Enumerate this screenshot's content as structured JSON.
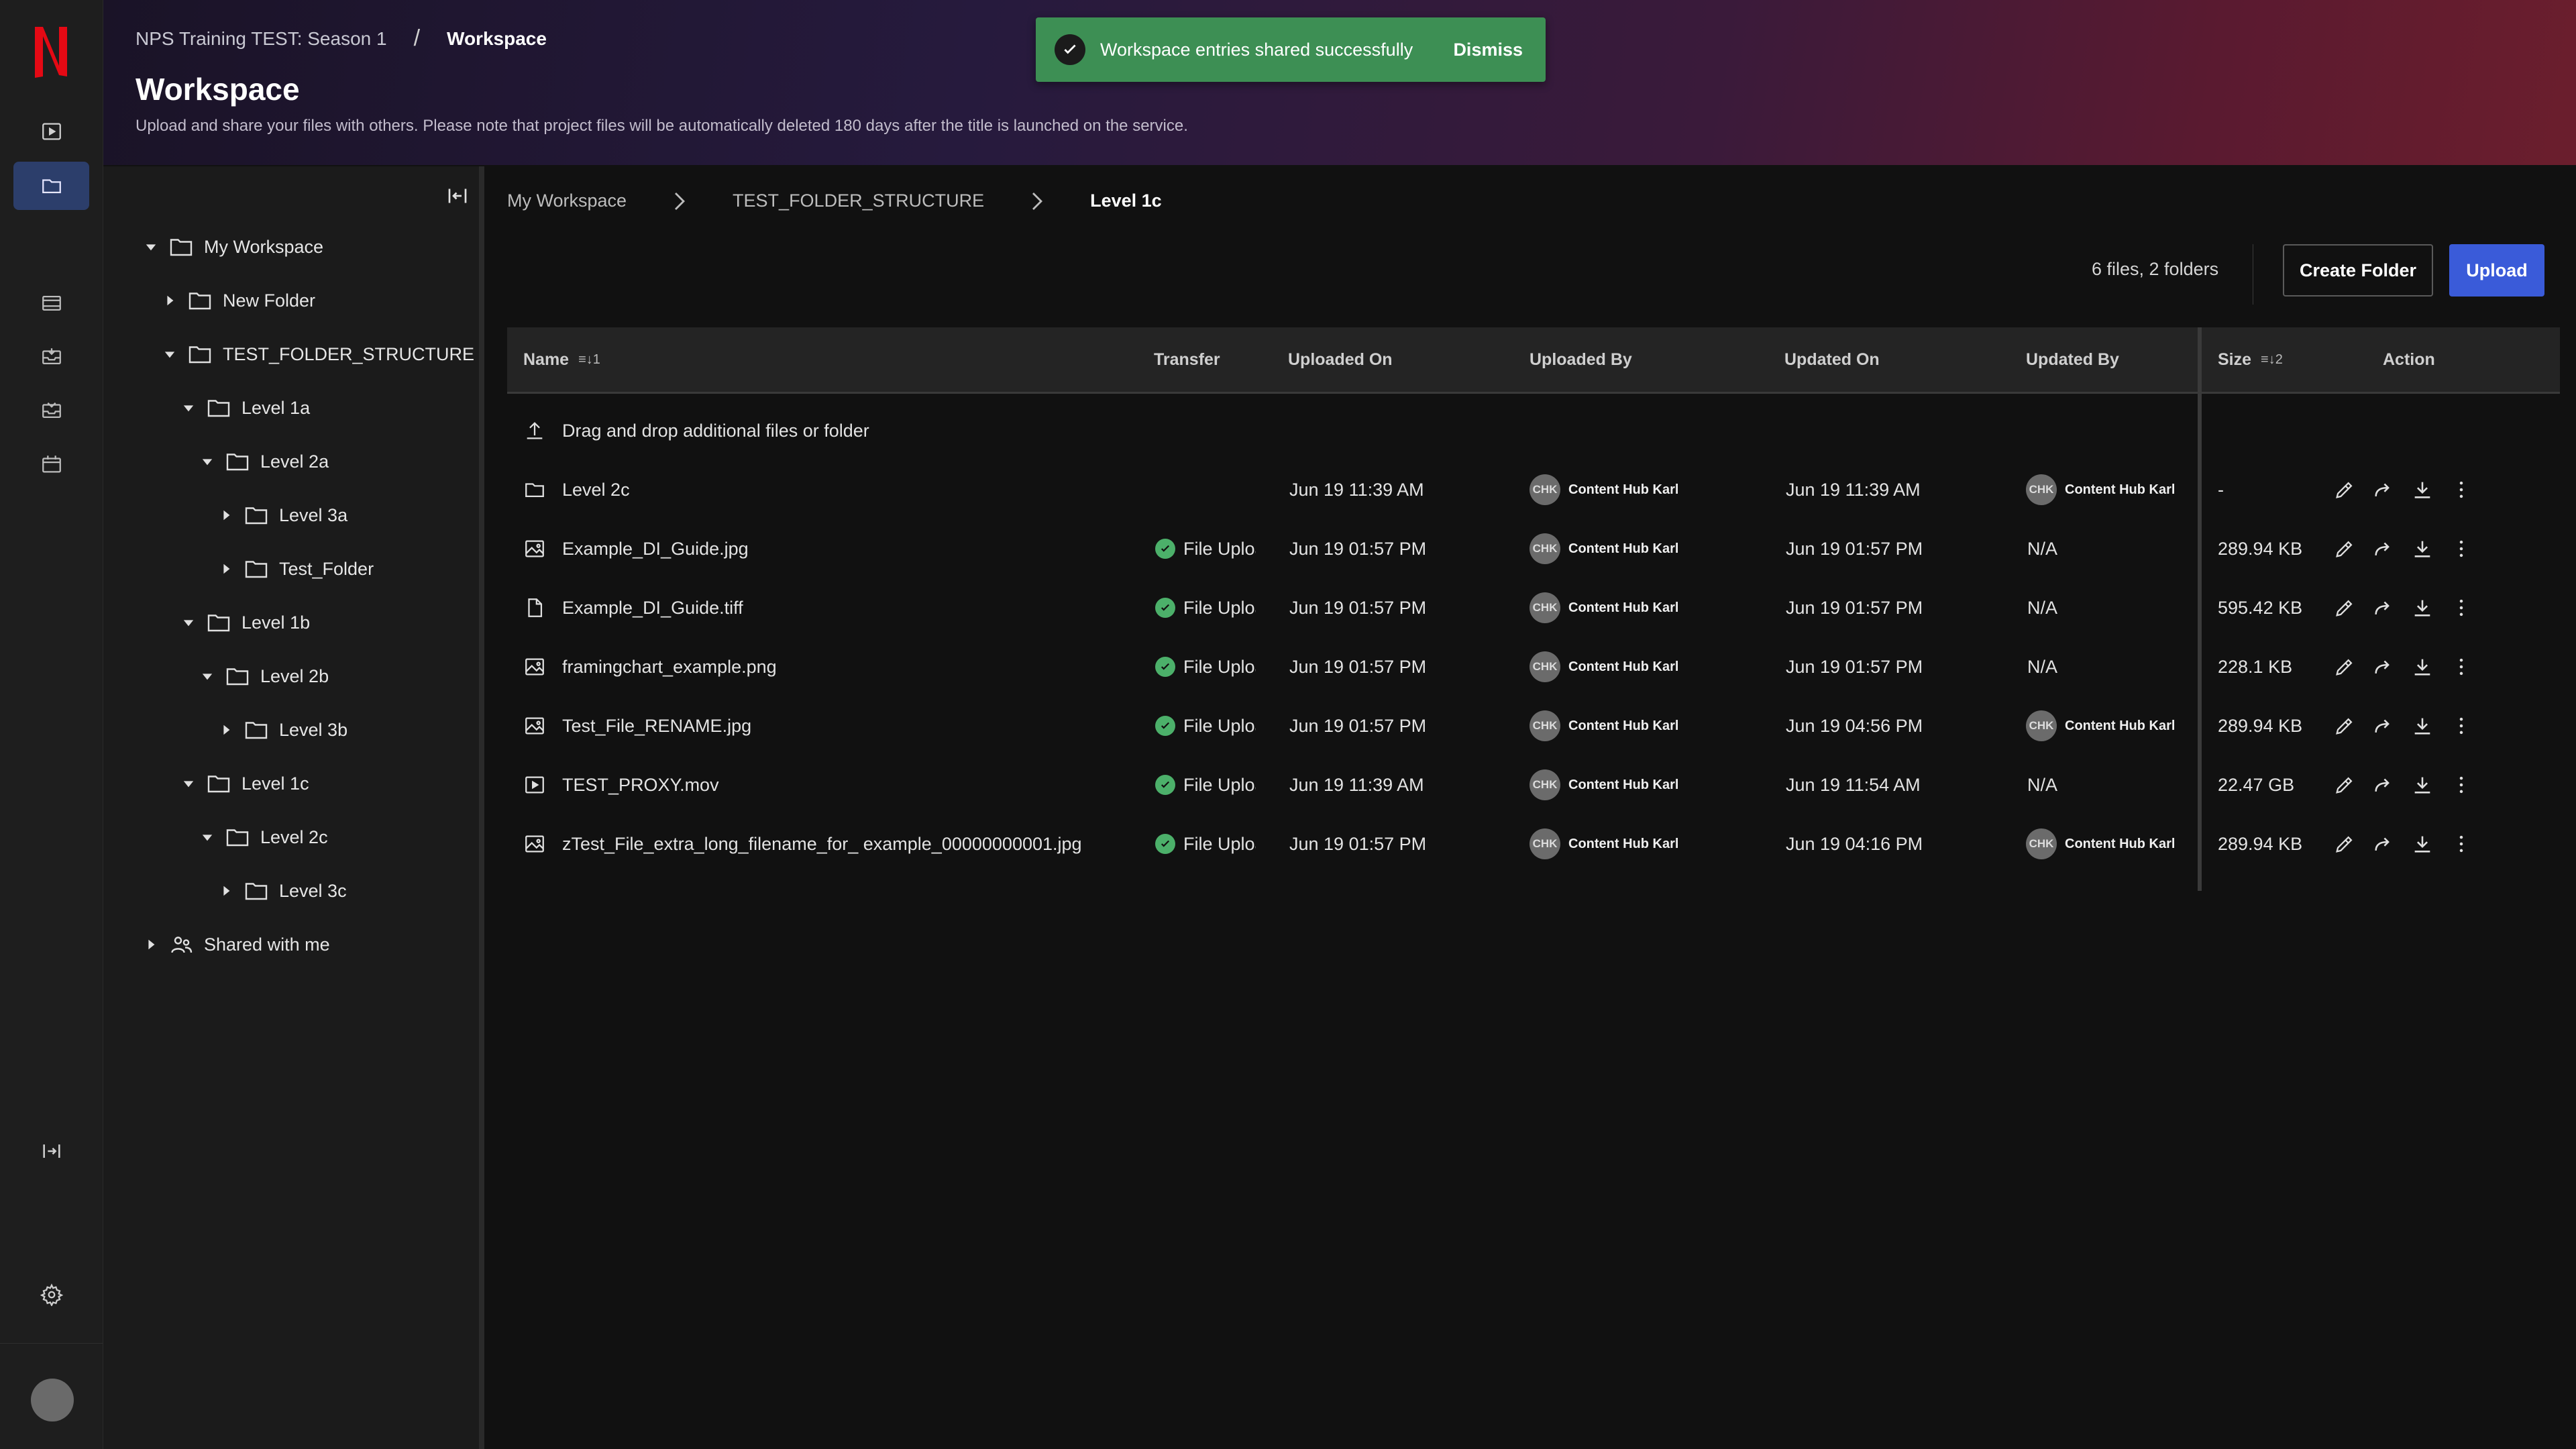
{
  "header": {
    "breadcrumb_project": "NPS Training TEST: Season 1",
    "breadcrumb_sep": "/",
    "breadcrumb_current": "Workspace",
    "title": "Workspace",
    "subtitle": "Upload and share your files with others. Please note that project files will be automatically deleted 180 days after the title is launched on the service."
  },
  "toast": {
    "message": "Workspace entries shared successfully",
    "dismiss_label": "Dismiss",
    "color": "#3d8f54"
  },
  "rail": {
    "icons": [
      "netflix-logo",
      "video-icon",
      "folder-icon",
      "film-icon",
      "inbox-icon",
      "inbox-download-icon",
      "calendar-icon",
      "expand-panel-icon",
      "gear-icon",
      "avatar"
    ]
  },
  "tree": {
    "items": [
      {
        "label": "My Workspace",
        "expanded": true
      },
      {
        "label": "New Folder",
        "expanded": false
      },
      {
        "label": "TEST_FOLDER_STRUCTURE",
        "expanded": true
      },
      {
        "label": "Level 1a",
        "expanded": true
      },
      {
        "label": "Level 2a",
        "expanded": true
      },
      {
        "label": "Level 3a",
        "expanded": false
      },
      {
        "label": "Test_Folder",
        "expanded": false
      },
      {
        "label": "Level 1b",
        "expanded": true
      },
      {
        "label": "Level 2b",
        "expanded": true
      },
      {
        "label": "Level 3b",
        "expanded": false
      },
      {
        "label": "Level 1c",
        "expanded": true
      },
      {
        "label": "Level 2c",
        "expanded": true
      },
      {
        "label": "Level 3c",
        "expanded": false
      },
      {
        "label": "Shared with me",
        "expanded": false
      }
    ]
  },
  "main": {
    "breadcrumb": [
      "My Workspace",
      "TEST_FOLDER_STRUCTURE",
      "Level 1c"
    ],
    "count": "6 files, 2 folders",
    "create_folder_label": "Create Folder",
    "upload_label": "Upload",
    "accent": "#3a5bd9"
  },
  "table": {
    "headers": {
      "name": "Name",
      "name_sort": "1",
      "transfer": "Transfer",
      "uploaded_on": "Uploaded On",
      "uploaded_by": "Uploaded By",
      "updated_on": "Updated On",
      "updated_by": "Updated By",
      "size": "Size",
      "size_sort": "2",
      "action": "Action"
    },
    "dropzone": "Drag and drop additional files or folder",
    "rows": [
      {
        "icon": "folder-icon",
        "name": "Level 2c",
        "transfer": "",
        "uploaded_on": "Jun 19 11:39 AM",
        "uploaded_by_initials": "CHK",
        "uploaded_by": "Content Hub Karl",
        "updated_on": "Jun 19 11:39 AM",
        "updated_by_initials": "CHK",
        "updated_by": "Content Hub Karl",
        "size": "-"
      },
      {
        "icon": "image-icon",
        "name": "Example_DI_Guide.jpg",
        "transfer": "File Uploa",
        "uploaded_on": "Jun 19 01:57 PM",
        "uploaded_by_initials": "CHK",
        "uploaded_by": "Content Hub Karl",
        "updated_on": "Jun 19 01:57 PM",
        "updated_by_initials": "",
        "updated_by": "N/A",
        "size": "289.94 KB"
      },
      {
        "icon": "file-icon",
        "name": "Example_DI_Guide.tiff",
        "transfer": "File Uploa",
        "uploaded_on": "Jun 19 01:57 PM",
        "uploaded_by_initials": "CHK",
        "uploaded_by": "Content Hub Karl",
        "updated_on": "Jun 19 01:57 PM",
        "updated_by_initials": "",
        "updated_by": "N/A",
        "size": "595.42 KB"
      },
      {
        "icon": "image-icon",
        "name": "framingchart_example.png",
        "transfer": "File Uploa",
        "uploaded_on": "Jun 19 01:57 PM",
        "uploaded_by_initials": "CHK",
        "uploaded_by": "Content Hub Karl",
        "updated_on": "Jun 19 01:57 PM",
        "updated_by_initials": "",
        "updated_by": "N/A",
        "size": "228.1 KB"
      },
      {
        "icon": "image-icon",
        "name": "Test_File_RENAME.jpg",
        "transfer": "File Uploa",
        "uploaded_on": "Jun 19 01:57 PM",
        "uploaded_by_initials": "CHK",
        "uploaded_by": "Content Hub Karl",
        "updated_on": "Jun 19 04:56 PM",
        "updated_by_initials": "CHK",
        "updated_by": "Content Hub Karl",
        "size": "289.94 KB"
      },
      {
        "icon": "video-icon",
        "name": "TEST_PROXY.mov",
        "transfer": "File Uploa",
        "uploaded_on": "Jun 19 11:39 AM",
        "uploaded_by_initials": "CHK",
        "uploaded_by": "Content Hub Karl",
        "updated_on": "Jun 19 11:54 AM",
        "updated_by_initials": "",
        "updated_by": "N/A",
        "size": "22.47 GB"
      },
      {
        "icon": "image-icon",
        "name": "zTest_File_extra_long_filename_for_ example_00000000001.jpg",
        "transfer": "File Uploa",
        "uploaded_on": "Jun 19 01:57 PM",
        "uploaded_by_initials": "CHK",
        "uploaded_by": "Content Hub Karl",
        "updated_on": "Jun 19 04:16 PM",
        "updated_by_initials": "CHK",
        "updated_by": "Content Hub Karl",
        "size": "289.94 KB"
      }
    ]
  }
}
